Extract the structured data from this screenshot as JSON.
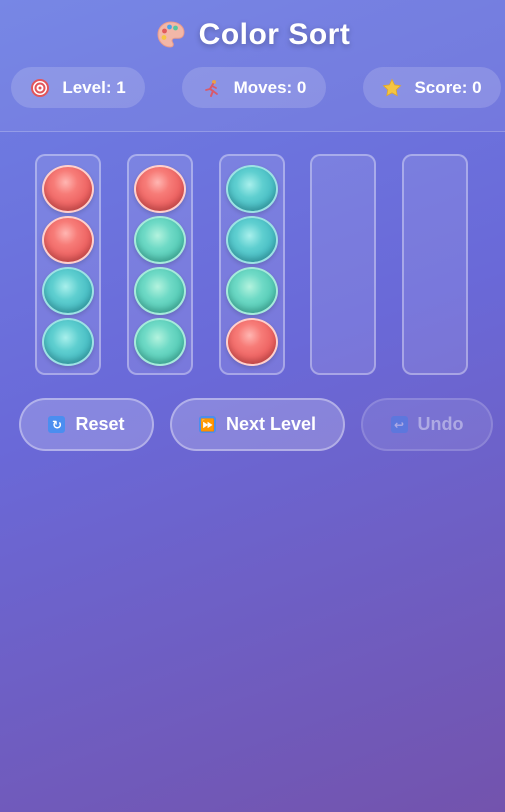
{
  "header": {
    "title": "Color Sort",
    "icon": "palette-icon"
  },
  "stats": {
    "level_label": "Level: 1",
    "moves_label": "Moves: 0",
    "score_label": "Score: 0"
  },
  "tubes": [
    {
      "balls": [
        "red",
        "red",
        "teal",
        "teal"
      ]
    },
    {
      "balls": [
        "red",
        "mint",
        "mint",
        "mint"
      ]
    },
    {
      "balls": [
        "teal",
        "teal",
        "mint",
        "red"
      ]
    },
    {
      "balls": []
    },
    {
      "balls": []
    }
  ],
  "controls": {
    "reset_label": "Reset",
    "next_label": "Next Level",
    "undo_label": "Undo",
    "undo_enabled": false
  },
  "colors": {
    "red": "#f06e6c",
    "teal": "#4cc3c9",
    "mint": "#5fd3bd",
    "accent": "#6a69d8"
  }
}
